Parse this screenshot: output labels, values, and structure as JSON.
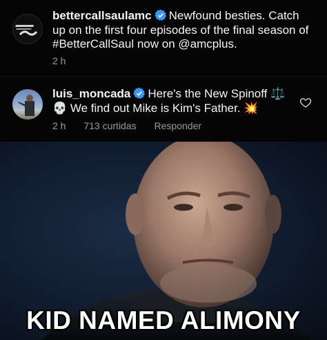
{
  "post": {
    "username": "bettercallsaulamc",
    "text": "Newfound besties. Catch up on the first four episodes of the final season of #BetterCallSaul now on @amcplus.",
    "time": "2 h",
    "avatar_icon": "better-call-saul-logo"
  },
  "reply": {
    "username": "luis_moncada",
    "text": "Here's the New Spinoff ⚖️💀 We find out Mike is Kim's Father. 💥",
    "time": "2 h",
    "likes": "713 curtidas",
    "reply_label": "Responder",
    "avatar_icon": "user-avatar"
  },
  "meme": {
    "caption": "KID NAMED ALIMONY"
  },
  "colors": {
    "background": "#000000",
    "text": "#f5f5f5",
    "meta": "#9a9a9a",
    "verified": "#3897f0"
  }
}
